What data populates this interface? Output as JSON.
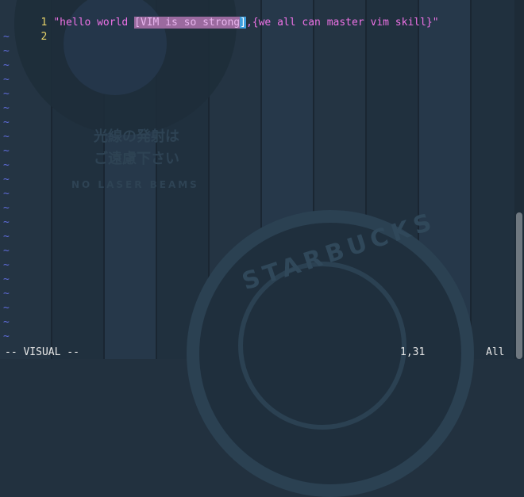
{
  "editor": {
    "lines": [
      {
        "number": "1",
        "before": "\"hello world ",
        "selected": "[VIM is so strong",
        "cursor": "]",
        "after": ",{we all can master vim skill}\""
      },
      {
        "number": "2",
        "text": ""
      }
    ],
    "empty_marker": "~",
    "empty_line_count": 22
  },
  "statusbar": {
    "mode": "-- VISUAL --",
    "position": "1,31",
    "percent": "All"
  },
  "background_art": {
    "jp_line1": "光線の発射は",
    "jp_line2": "ご遠慮下さい",
    "caption": "NO LASER BEAMS",
    "logo_text": "STARBUCKS"
  },
  "colors": {
    "line_number": "#e8d46a",
    "string_text": "#ee72e6",
    "selection_bg": "#9b6a9f",
    "cursor_bg": "#3e9fde",
    "tilde": "#5e6bd8",
    "status_text": "#e7e7e7"
  }
}
